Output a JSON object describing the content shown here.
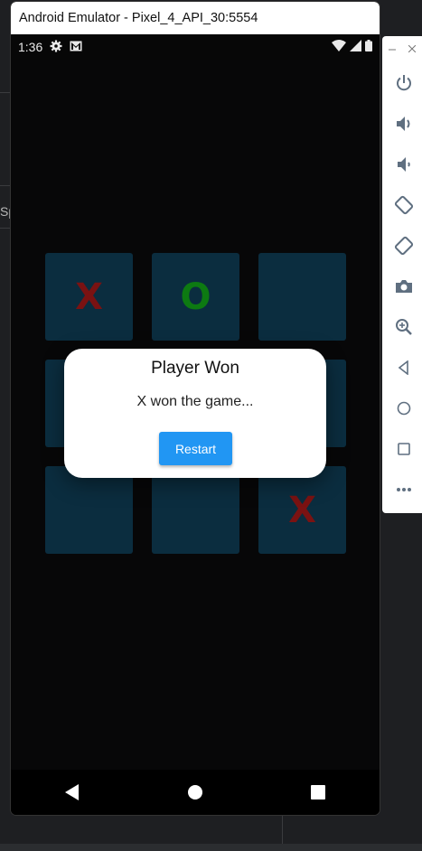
{
  "window": {
    "title": "Android Emulator - Pixel_4_API_30:5554"
  },
  "status_bar": {
    "time": "1:36"
  },
  "game": {
    "board": [
      {
        "mark": "X",
        "color": "#7a1212"
      },
      {
        "mark": "O",
        "color": "#0d7a12"
      },
      {
        "mark": "",
        "color": ""
      },
      {
        "mark": "",
        "color": ""
      },
      {
        "mark": "",
        "color": ""
      },
      {
        "mark": "",
        "color": ""
      },
      {
        "mark": "",
        "color": ""
      },
      {
        "mark": "",
        "color": ""
      },
      {
        "mark": "X",
        "color": "#7a1212"
      }
    ]
  },
  "dialog": {
    "title": "Player Won",
    "message": "X won the game...",
    "button_label": "Restart"
  },
  "background_ide": {
    "left_fragment": "Sp"
  },
  "colors": {
    "accent": "#2196f3",
    "cell": "#0b2d3f"
  }
}
